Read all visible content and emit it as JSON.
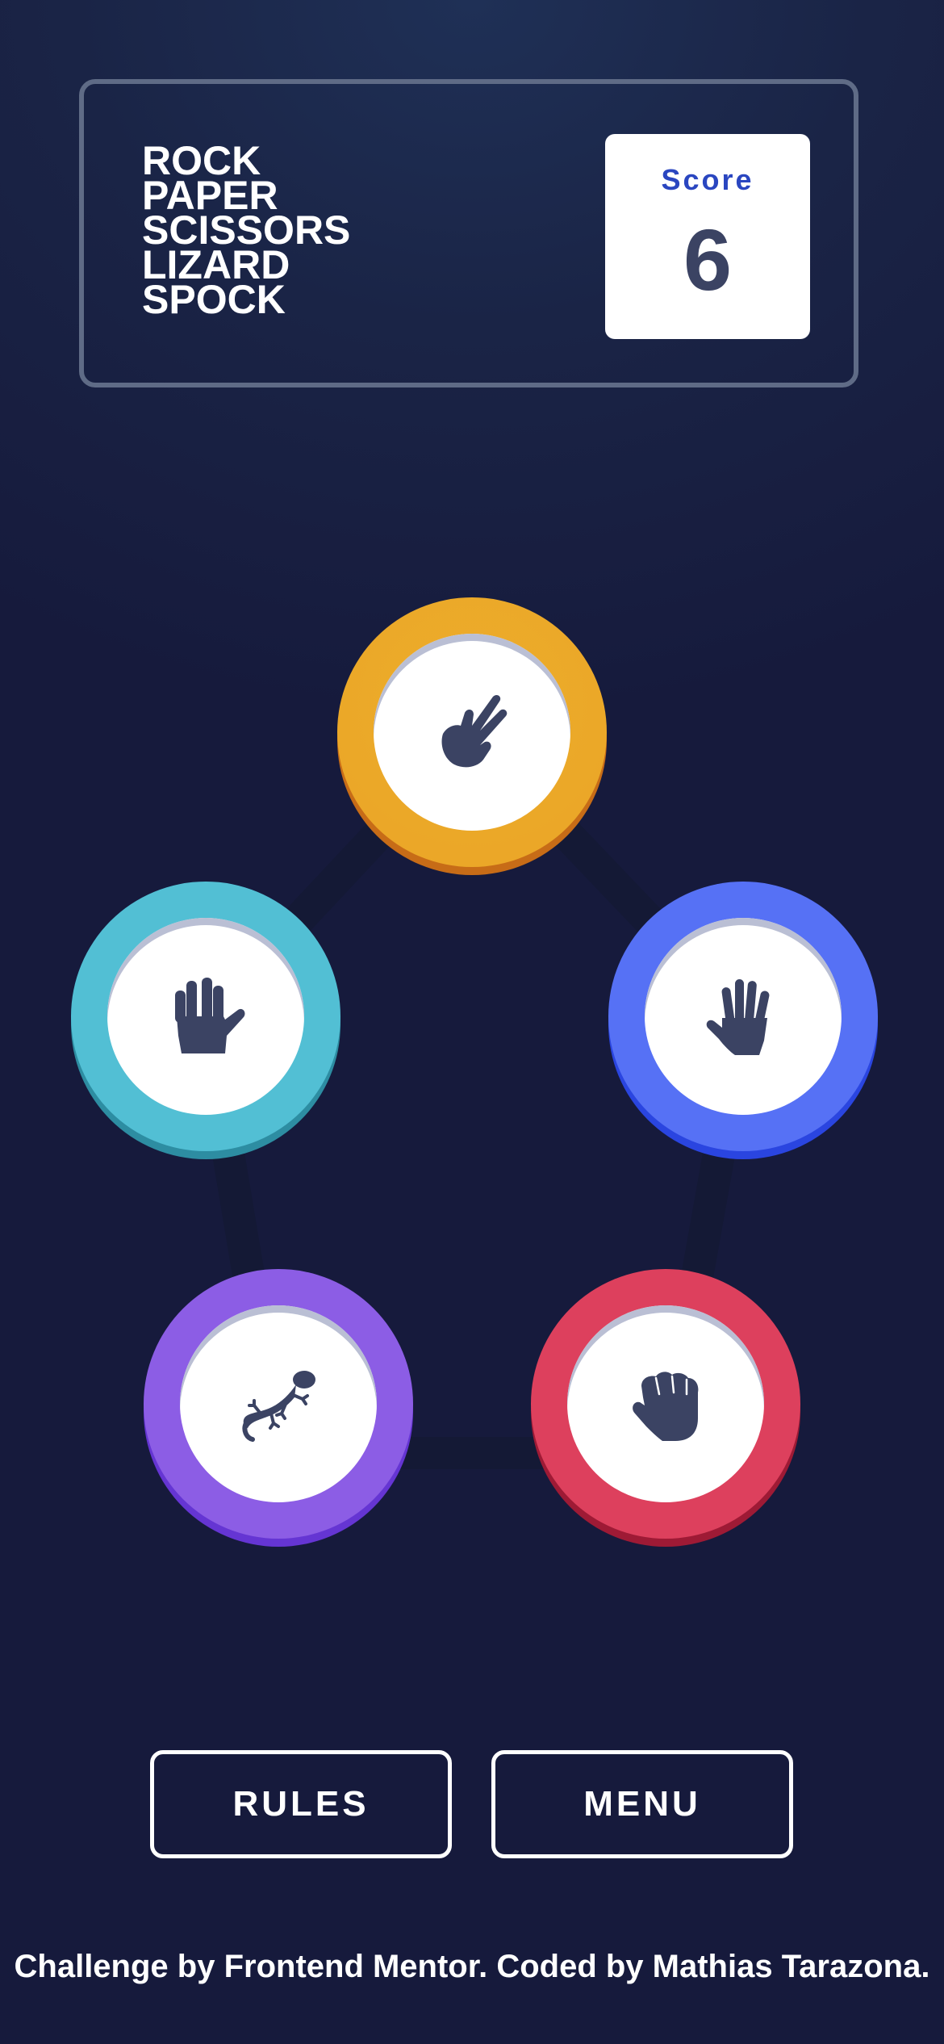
{
  "header": {
    "title_lines": [
      "ROCK",
      "PAPER",
      "SCISSORS",
      "LIZARD",
      "SPOCK"
    ],
    "score_label": "Score",
    "score_value": "6"
  },
  "tokens": [
    {
      "choice": "scissors",
      "icon": "scissors-hand-icon",
      "color": "#eba728"
    },
    {
      "choice": "spock",
      "icon": "spock-hand-icon",
      "color": "#52bfd4"
    },
    {
      "choice": "paper",
      "icon": "paper-hand-icon",
      "color": "#5671f5"
    },
    {
      "choice": "lizard",
      "icon": "lizard-icon",
      "color": "#8c5de5"
    },
    {
      "choice": "rock",
      "icon": "rock-fist-icon",
      "color": "#dd405d"
    }
  ],
  "buttons": {
    "rules": "RULES",
    "menu": "MENU"
  },
  "footer": {
    "text": "Challenge by Frontend Mentor. Coded by Mathias Tarazona."
  },
  "colors": {
    "background_top": "#1f3056",
    "background_bottom": "#161a3c",
    "header_border": "#5f6b86",
    "score_label": "#2a46c0",
    "score_value": "#3b4363"
  }
}
